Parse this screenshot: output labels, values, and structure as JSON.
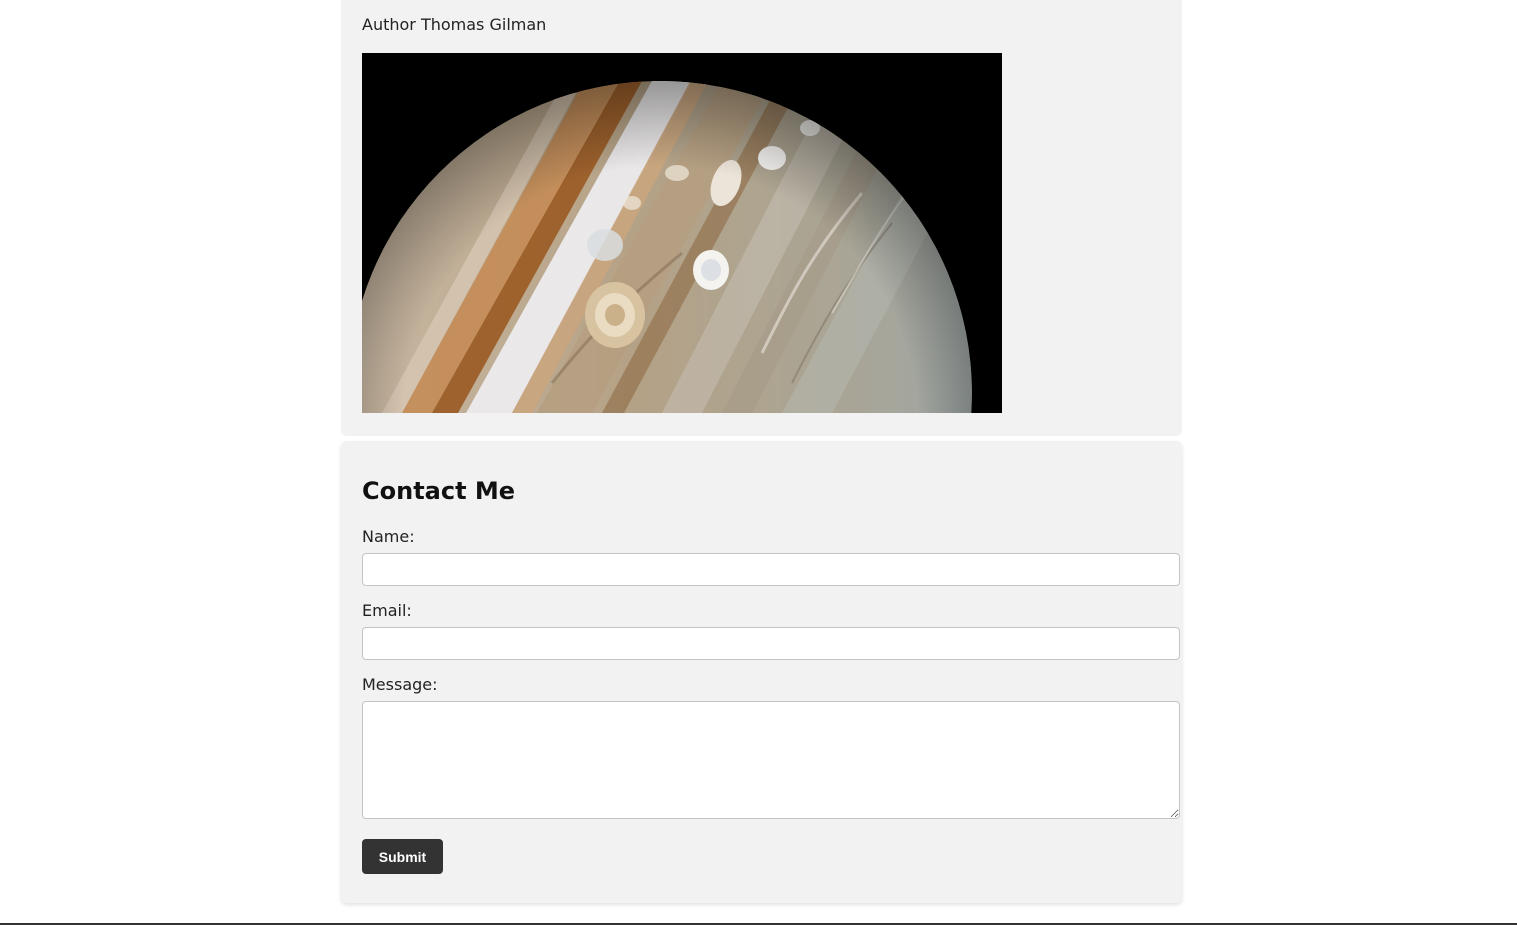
{
  "article": {
    "author_line": "Author Thomas Gilman",
    "image": {
      "subject": "planet Jupiter",
      "colors": {
        "background": "#000000",
        "planet_base": "#b8a78e",
        "band_orange": "#b06a2c",
        "band_light": "#e8e8ea",
        "storm_white": "#f2f1ee"
      }
    }
  },
  "contact": {
    "title": "Contact Me",
    "name_label": "Name:",
    "name_value": "",
    "email_label": "Email:",
    "email_value": "",
    "message_label": "Message:",
    "message_value": "",
    "submit_label": "Submit"
  },
  "colors": {
    "page_background": "#ffffff",
    "card_background": "#f2f2f2",
    "button_background": "#333333",
    "button_text": "#ffffff"
  }
}
